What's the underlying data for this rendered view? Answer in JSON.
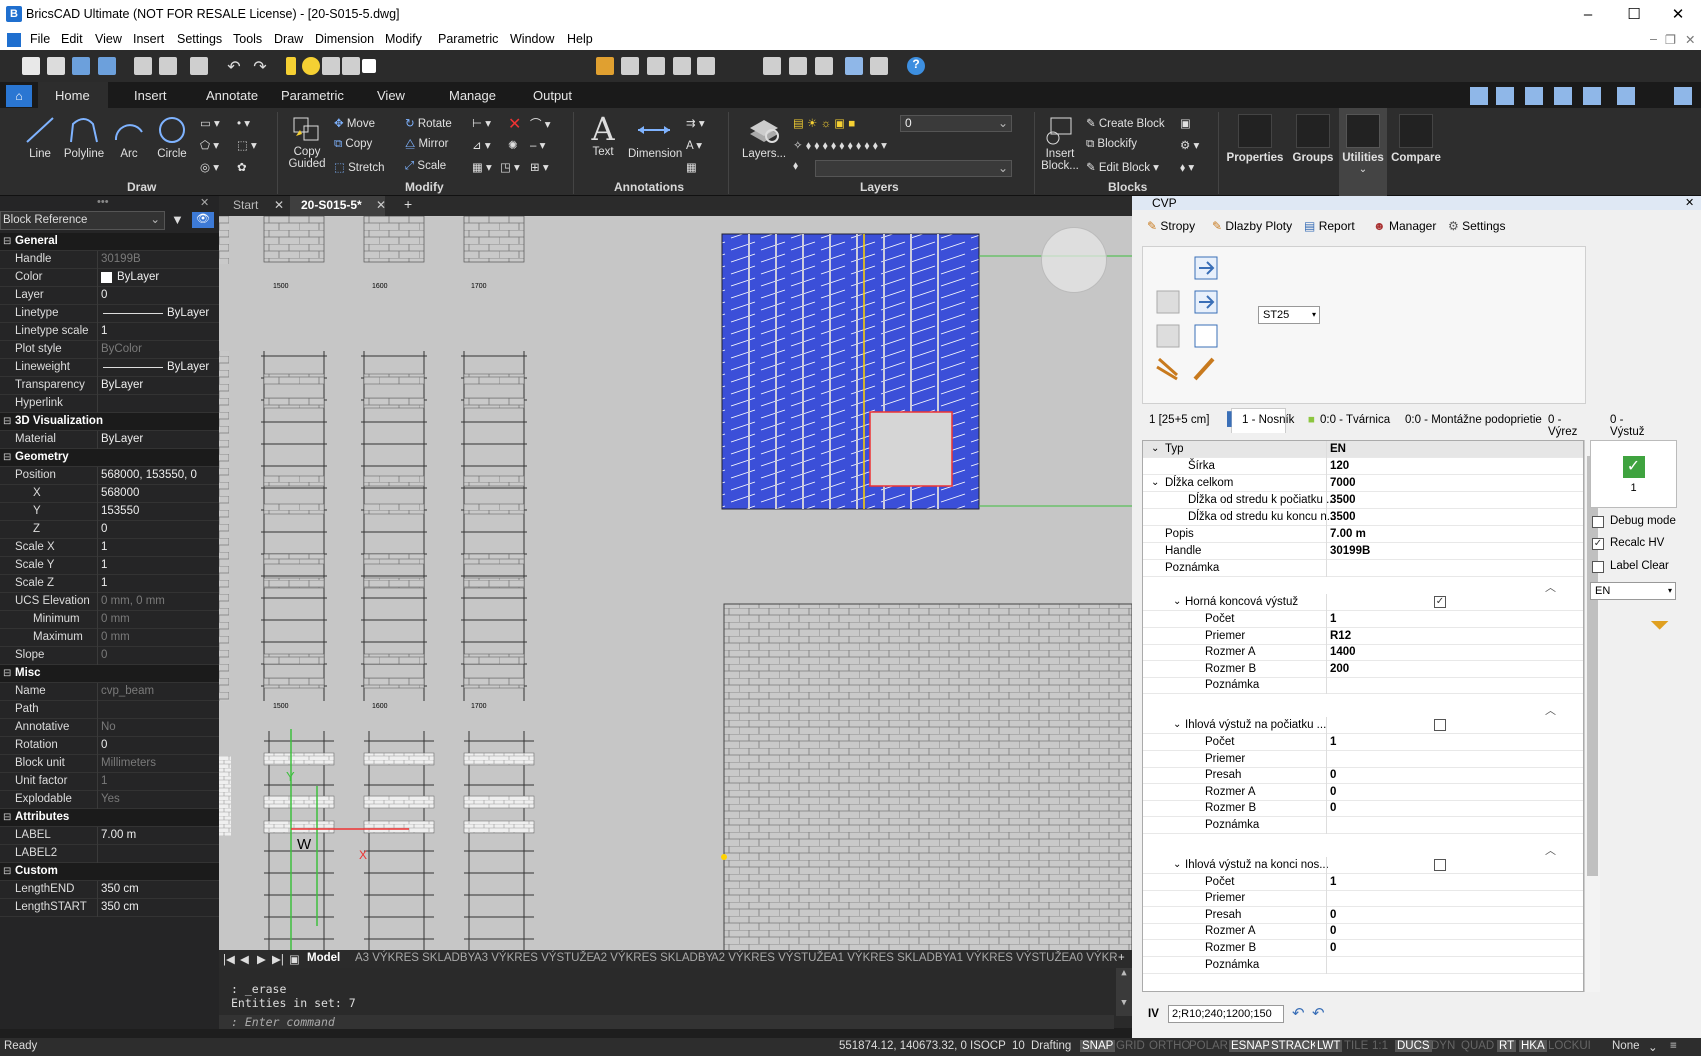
{
  "titlebar": {
    "title": "BricsCAD Ultimate (NOT FOR RESALE License) - [20-S015-5.dwg]",
    "minimize": "–",
    "maximize": "☐",
    "close": "✕"
  },
  "menu": [
    "File",
    "Edit",
    "View",
    "Insert",
    "Settings",
    "Tools",
    "Draw",
    "Dimension",
    "Modify",
    "Parametric",
    "Window",
    "Help"
  ],
  "qat": {
    "layer_value": "0"
  },
  "ribbon": {
    "tabs": [
      "Home",
      "Insert",
      "Annotate",
      "Parametric",
      "View",
      "Manage",
      "Output"
    ],
    "draw": {
      "label": "Draw",
      "line": "Line",
      "polyline": "Polyline",
      "arc": "Arc",
      "circle": "Circle"
    },
    "modify": {
      "label": "Modify",
      "copy_guided": "Copy Guided",
      "move": "Move",
      "copy": "Copy",
      "stretch": "Stretch",
      "rotate": "Rotate",
      "mirror": "Mirror",
      "scale": "Scale"
    },
    "annotations": {
      "label": "Annotations",
      "text": "Text",
      "dimension": "Dimension"
    },
    "layers": {
      "label": "Layers",
      "layers_btn": "Layers...",
      "layer_value": "0"
    },
    "blocks": {
      "label": "Blocks",
      "insert_block": "Insert Block...",
      "create_block": "Create Block",
      "blockify": "Blockify",
      "edit_block": "Edit Block"
    },
    "panels": {
      "properties": "Properties",
      "groups": "Groups",
      "utilities": "Utilities",
      "compare": "Compare"
    }
  },
  "properties": {
    "selection": "Block Reference",
    "rows": [
      {
        "cat": true,
        "k": "General"
      },
      {
        "k": "Handle",
        "v": "30199B",
        "dim": true
      },
      {
        "k": "Color",
        "v": "ByLayer",
        "swatch": true
      },
      {
        "k": "Layer",
        "v": "0"
      },
      {
        "k": "Linetype",
        "v": "ByLayer",
        "line": true
      },
      {
        "k": "Linetype scale",
        "v": "1"
      },
      {
        "k": "Plot style",
        "v": "ByColor",
        "dim": true
      },
      {
        "k": "Lineweight",
        "v": "ByLayer",
        "line": true
      },
      {
        "k": "Transparency",
        "v": "ByLayer"
      },
      {
        "k": "Hyperlink",
        "v": ""
      },
      {
        "cat": true,
        "k": "3D Visualization"
      },
      {
        "k": "Material",
        "v": "ByLayer"
      },
      {
        "cat": true,
        "k": "Geometry"
      },
      {
        "k": "Position",
        "v": "568000, 153550, 0"
      },
      {
        "k": "X",
        "v": "568000",
        "indent": true
      },
      {
        "k": "Y",
        "v": "153550",
        "indent": true
      },
      {
        "k": "Z",
        "v": "0",
        "indent": true
      },
      {
        "k": "Scale X",
        "v": "1"
      },
      {
        "k": "Scale Y",
        "v": "1"
      },
      {
        "k": "Scale Z",
        "v": "1"
      },
      {
        "k": "UCS Elevation",
        "v": "0 mm, 0 mm",
        "dim": true
      },
      {
        "k": "Minimum",
        "v": "0 mm",
        "dim": true,
        "indent": true
      },
      {
        "k": "Maximum",
        "v": "0 mm",
        "dim": true,
        "indent": true
      },
      {
        "k": "Slope",
        "v": "0",
        "dim": true
      },
      {
        "cat": true,
        "k": "Misc"
      },
      {
        "k": "Name",
        "v": "cvp_beam",
        "dim": true
      },
      {
        "k": "Path",
        "v": ""
      },
      {
        "k": "Annotative",
        "v": "No",
        "dim": true
      },
      {
        "k": "Rotation",
        "v": "0"
      },
      {
        "k": "Block unit",
        "v": "Millimeters",
        "dim": true
      },
      {
        "k": "Unit factor",
        "v": "1",
        "dim": true
      },
      {
        "k": "Explodable",
        "v": "Yes",
        "dim": true
      },
      {
        "cat": true,
        "k": "Attributes"
      },
      {
        "k": "LABEL",
        "v": "7.00 m"
      },
      {
        "k": "LABEL2",
        "v": ""
      },
      {
        "cat": true,
        "k": "Custom"
      },
      {
        "k": "LengthEND",
        "v": "350 cm"
      },
      {
        "k": "LengthSTART",
        "v": "350 cm"
      }
    ]
  },
  "doctabs": {
    "start": "Start",
    "active": "20-S015-5*",
    "add": "+"
  },
  "canvas": {
    "labels_top": [
      "1500",
      "1600",
      "1700"
    ],
    "labels_mid": [
      "1500",
      "1600",
      "1700"
    ],
    "ucs_y": "Y",
    "ucs_w": "W",
    "ucs_x": "X"
  },
  "layouttabs": {
    "model": "Model",
    "tabs": [
      "A3 VÝKRES SKLADBY",
      "A3 VÝKRES VÝSTUŽE",
      "A2 VÝKRES SKLADBY",
      "A2 VÝKRES VÝSTUŽE",
      "A1 VÝKRES SKLADBY",
      "A1 VÝKRES VÝSTUŽE",
      "A0 VÝKR"
    ]
  },
  "cmd": {
    "line1": ": _erase",
    "line2": "Entities in set: 7",
    "prompt": ": Enter command"
  },
  "status": {
    "ready": "Ready",
    "coords": "551874.12, 140673.32, 0",
    "isocp": "ISOCP",
    "ten": "10",
    "drafting": "Drafting",
    "toggles": [
      {
        "t": "SNAP",
        "on": true
      },
      {
        "t": "GRID",
        "on": false
      },
      {
        "t": "ORTHO",
        "on": false
      },
      {
        "t": "POLAR",
        "on": false
      },
      {
        "t": "ESNAP",
        "on": true
      },
      {
        "t": "STRACK",
        "on": true
      },
      {
        "t": "LWT",
        "on": true
      },
      {
        "t": "TILE",
        "on": false
      },
      {
        "t": "1:1",
        "on": false
      },
      {
        "t": "DUCS",
        "on": true
      },
      {
        "t": "DYN",
        "on": false
      },
      {
        "t": "QUAD",
        "on": false
      },
      {
        "t": "RT",
        "on": true
      },
      {
        "t": "HKA",
        "on": true
      },
      {
        "t": "LOCKUI",
        "on": false
      }
    ],
    "none": "None"
  },
  "cvp": {
    "title": "CVP",
    "toolbar": [
      "Stropy",
      "Dlazby Ploty",
      "Report",
      "Manager",
      "Settings"
    ],
    "st25": "ST25",
    "tabs": [
      "1 [25+5 cm]",
      "1 - Nosník",
      "0:0 - Tvárnica",
      "0:0 - Montážne podoprietie",
      "0 - Výrez",
      "0 - Výstuž"
    ],
    "table": [
      {
        "k": "Typ",
        "v": "EN",
        "lvl": 0,
        "exp": true,
        "sel": true
      },
      {
        "k": "Šírka",
        "v": "120",
        "lvl": 2
      },
      {
        "k": "Dĺžka celkom",
        "v": "7000",
        "lvl": 0,
        "exp": true
      },
      {
        "k": "Dĺžka od stredu k počiatku ...",
        "v": "3500",
        "lvl": 2
      },
      {
        "k": "Dĺžka od stredu ku koncu n...",
        "v": "3500",
        "lvl": 2
      },
      {
        "k": "Popis",
        "v": "7.00 m",
        "lvl": 1
      },
      {
        "k": "Handle",
        "v": "30199B",
        "lvl": 1
      },
      {
        "k": "Poznámka",
        "v": "",
        "lvl": 1
      }
    ],
    "sections": [
      {
        "title": "Horná koncová výstuž",
        "checked": true,
        "rows": [
          [
            "Počet",
            "1"
          ],
          [
            "Priemer",
            "R12"
          ],
          [
            "Rozmer A",
            "1400"
          ],
          [
            "Rozmer B",
            "200"
          ],
          [
            "Poznámka",
            ""
          ]
        ]
      },
      {
        "title": "Ihlová výstuž na počiatku ...",
        "checked": false,
        "rows": [
          [
            "Počet",
            "1"
          ],
          [
            "Priemer",
            ""
          ],
          [
            "Presah",
            "0"
          ],
          [
            "Rozmer A",
            "0"
          ],
          [
            "Rozmer B",
            "0"
          ],
          [
            "Poznámka",
            ""
          ]
        ]
      },
      {
        "title": "Ihlová výstuž na konci nos...",
        "checked": false,
        "rows": [
          [
            "Počet",
            "1"
          ],
          [
            "Priemer",
            ""
          ],
          [
            "Presah",
            "0"
          ],
          [
            "Rozmer A",
            "0"
          ],
          [
            "Rozmer B",
            "0"
          ],
          [
            "Poznámka",
            ""
          ]
        ]
      }
    ],
    "right": {
      "count": "1",
      "debug": "Debug mode",
      "recalc": "Recalc HV",
      "labelclear": "Label Clear",
      "lang": "EN"
    },
    "iv": {
      "label": "IV",
      "value": "2;R10;240;1200;150"
    }
  }
}
